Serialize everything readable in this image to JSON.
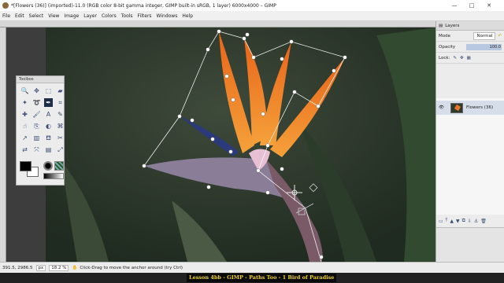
{
  "window": {
    "title": "*[Flowers (36)] (imported)-11.0 (RGB color 8-bit gamma integer, GIMP built-in sRGB, 1 layer) 6000x4000 – GIMP",
    "minimize": "—",
    "maximize": "□",
    "close": "✕"
  },
  "menu": [
    "File",
    "Edit",
    "Select",
    "View",
    "Image",
    "Layer",
    "Colors",
    "Tools",
    "Filters",
    "Windows",
    "Help"
  ],
  "toolbox": {
    "title": "Toolbox",
    "tools": [
      {
        "name": "zoom-tool-icon",
        "glyph": "🔍"
      },
      {
        "name": "move-tool-icon",
        "glyph": "✥"
      },
      {
        "name": "rect-select-icon",
        "glyph": "⬚"
      },
      {
        "name": "eraser-icon",
        "glyph": "▰"
      },
      {
        "name": "fuzzy-select-icon",
        "glyph": "✦"
      },
      {
        "name": "free-select-icon",
        "glyph": "➰"
      },
      {
        "name": "paths-tool-icon",
        "glyph": "✒"
      },
      {
        "name": "crop-tool-icon",
        "glyph": "⌗"
      },
      {
        "name": "heal-tool-icon",
        "glyph": "✚"
      },
      {
        "name": "paintbrush-icon",
        "glyph": "🖌"
      },
      {
        "name": "text-tool-icon",
        "glyph": "A"
      },
      {
        "name": "color-picker-icon",
        "glyph": "✎"
      },
      {
        "name": "smudge-tool-icon",
        "glyph": "☝"
      },
      {
        "name": "clone-tool-icon",
        "glyph": "⎘"
      },
      {
        "name": "dodge-burn-icon",
        "glyph": "◐"
      },
      {
        "name": "warp-tool-icon",
        "glyph": "⌘"
      },
      {
        "name": "airbrush-icon",
        "glyph": "↗"
      },
      {
        "name": "blend-tool-icon",
        "glyph": "▥"
      },
      {
        "name": "bucket-fill-icon",
        "glyph": "⛾"
      },
      {
        "name": "measure-tool-icon",
        "glyph": "✂"
      },
      {
        "name": "transform-tool-icon",
        "glyph": "⇄"
      },
      {
        "name": "unified-transform-icon",
        "glyph": "⤧"
      },
      {
        "name": "align-tool-icon",
        "glyph": "▤"
      },
      {
        "name": "scale-tool-icon",
        "glyph": "⤢"
      }
    ]
  },
  "layers_dock": {
    "tab_label": "Layers",
    "mode_label": "Mode",
    "mode_value": "Normal",
    "opacity_label": "Opacity",
    "opacity_value": "100.0",
    "opacity_fraction": 1.0,
    "lock_label": "Lock:",
    "layer_name": "Flowers (36)",
    "actions": [
      "▭",
      "⤒",
      "▲",
      "▼",
      "⧉",
      "⇩",
      "⚓",
      "🗑"
    ]
  },
  "status": {
    "coords": "391.5, 2986.5",
    "unit": "px",
    "zoom": "18.2 %",
    "message": "Click-Drag to move the anchor around (try Ctrl)"
  },
  "caption": "Lesson 4bb - GIMP - Paths Too - 1 Bird of Paradise",
  "colors": {
    "accent": "#1f2d4a",
    "path_line": "#ffffff",
    "caption_text": "#f2d21d",
    "petal_orange": "#f07a1e",
    "petal_blue": "#2b3a7a",
    "bract": "#8a7d98"
  }
}
